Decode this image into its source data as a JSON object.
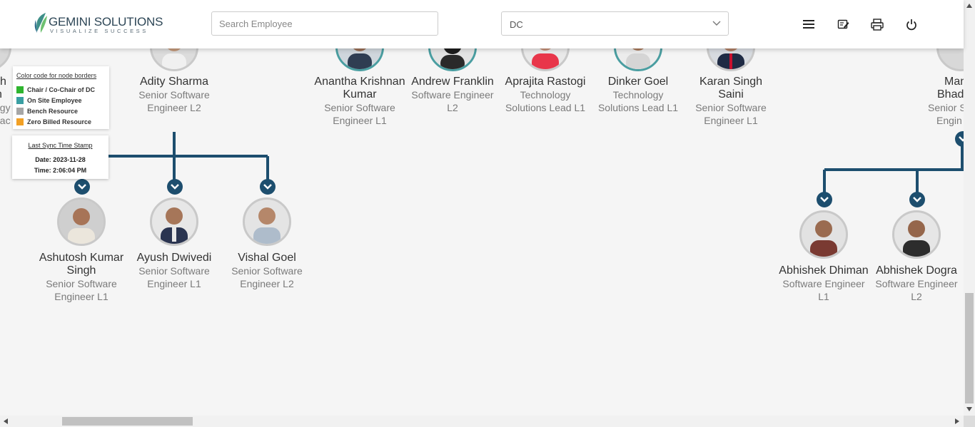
{
  "header": {
    "logo_name": "GEMINI SOLUTIONS",
    "logo_tagline": "VISUALIZE SUCCESS",
    "search_placeholder": "Search Employee",
    "filter_value": "DC"
  },
  "legend": {
    "title": "Color code for node borders",
    "items": [
      {
        "label": "Chair / Co-Chair of DC",
        "color": "#2fb52f"
      },
      {
        "label": "On Site Employee",
        "color": "#3a9fa3"
      },
      {
        "label": "Bench Resource",
        "color": "#a6a6a6"
      },
      {
        "label": "Zero Billed Resource",
        "color": "#f2a024"
      }
    ]
  },
  "sync": {
    "title": "Last Sync Time Stamp",
    "date": "Date: 2023-11-28",
    "time": "Time: 2:06:04 PM"
  },
  "partial_left": {
    "lines": [
      "sh",
      "n",
      "ogy",
      "eac"
    ]
  },
  "partial_right": {
    "name_lines": [
      "Man",
      "Bhad"
    ],
    "title_lines": [
      "Senior S",
      "Engin"
    ]
  },
  "top_nodes": [
    {
      "name": "Adity Sharma",
      "title": "Senior Software Engineer L2",
      "border": "grey"
    },
    {
      "name": "Anantha Krishnan Kumar",
      "title": "Senior Software Engineer L1",
      "border": "teal"
    },
    {
      "name": "Andrew Franklin",
      "title": "Software Engineer L2",
      "border": "teal"
    },
    {
      "name": "Aprajita Rastogi",
      "title": "Technology Solutions Lead L1",
      "border": "grey"
    },
    {
      "name": "Dinker Goel",
      "title": "Technology Solutions Lead L1",
      "border": "teal"
    },
    {
      "name": "Karan Singh Saini",
      "title": "Senior Software Engineer L1",
      "border": "grey"
    }
  ],
  "child_nodes": [
    {
      "name": "Ashutosh Kumar Singh",
      "title": "Senior Software Engineer L1",
      "border": "grey"
    },
    {
      "name": "Ayush Dwivedi",
      "title": "Senior Software Engineer L1",
      "border": "grey"
    },
    {
      "name": "Vishal Goel",
      "title": "Senior Software Engineer L2",
      "border": "grey"
    },
    {
      "name": "Abhishek Dhiman",
      "title": "Software Engineer L1",
      "border": "grey"
    },
    {
      "name": "Abhishek Dogra",
      "title": "Software Engineer L2",
      "border": "grey"
    }
  ],
  "icons": {
    "menu": "hamburger-menu-icon",
    "report": "edit-report-icon",
    "print": "printer-icon",
    "power": "power-icon",
    "expand": "chevron-down-icon"
  }
}
